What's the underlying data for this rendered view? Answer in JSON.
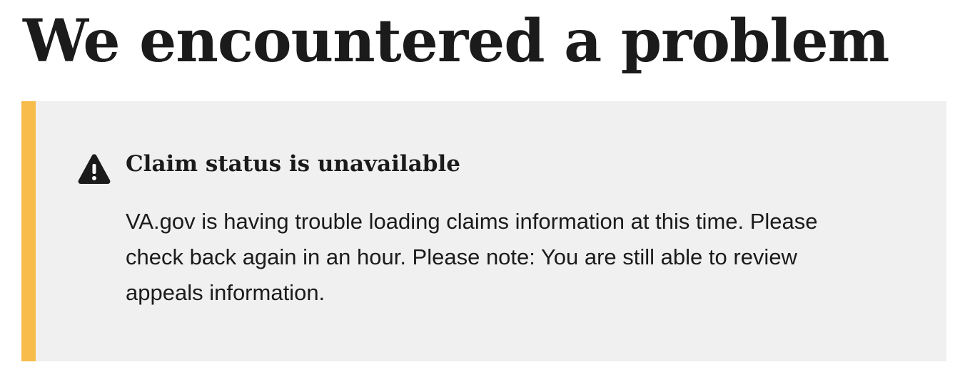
{
  "page": {
    "title": "We encountered a problem"
  },
  "alert": {
    "status": "warning",
    "icon": "warning-icon",
    "accent_color": "#f7bc4b",
    "background_color": "#f0f0f0",
    "heading": "Claim status is unavailable",
    "body": "VA.gov is having trouble loading claims information at this time. Please check back again in an hour. Please note: You are still able to review appeals information."
  }
}
